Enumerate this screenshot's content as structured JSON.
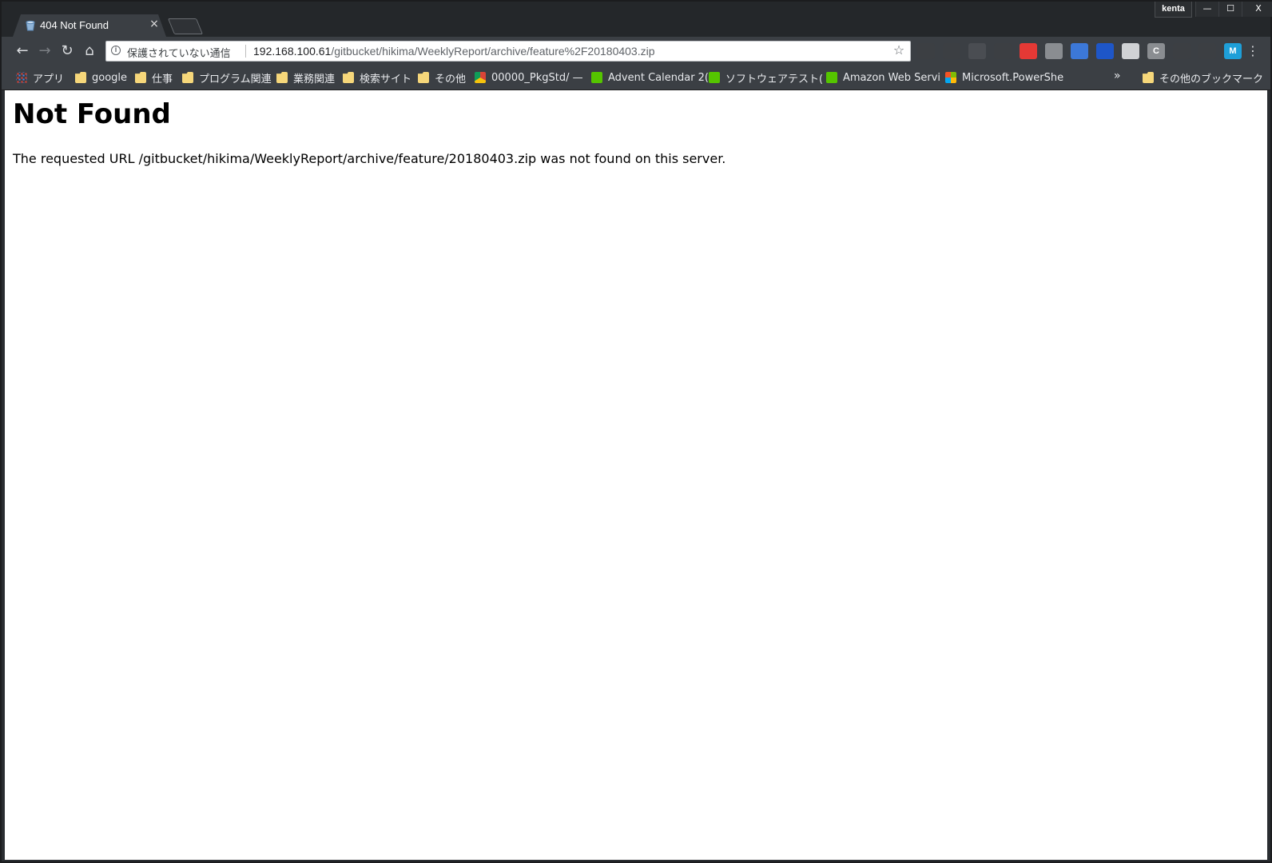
{
  "browser": {
    "tab": {
      "title": "404 Not Found",
      "close": "×",
      "icon": "gitbucket-icon"
    },
    "profile": "kenta",
    "window_controls": {
      "minimize": "—",
      "maximize": "☐",
      "close": "X"
    },
    "nav": {
      "back": "←",
      "forward": "→",
      "reload": "↻",
      "home": "⌂"
    },
    "omnibox": {
      "security_text": "保護されていない通信",
      "url_host": "192.168.100.61",
      "url_path": "/gitbucket/hikima/WeeklyReport/archive/feature%2F20180403.zip",
      "star": "☆"
    },
    "extensions": [
      {
        "name": "ext-1",
        "label": "",
        "color": "#3c3f43"
      },
      {
        "name": "ext-2",
        "label": "",
        "color": "#3c3f43"
      },
      {
        "name": "ext-3",
        "label": "",
        "color": "#4a4d52"
      },
      {
        "name": "ext-4",
        "label": "",
        "color": "#3c3f43"
      },
      {
        "name": "ext-5",
        "label": "",
        "color": "#e53935"
      },
      {
        "name": "ext-6",
        "label": "",
        "color": "#8a8d91"
      },
      {
        "name": "ext-7",
        "label": "",
        "color": "#3c78d8"
      },
      {
        "name": "ext-8",
        "label": "",
        "color": "#1e56c8"
      },
      {
        "name": "ext-9",
        "label": "",
        "color": "#d0d2d5"
      },
      {
        "name": "ext-10",
        "label": "C",
        "color": "#8a8d91"
      },
      {
        "name": "ext-11",
        "label": "",
        "color": "#3c3f43"
      },
      {
        "name": "ext-12",
        "label": "",
        "color": "#3c3f43"
      },
      {
        "name": "ext-13",
        "label": "M",
        "color": "#1e9fd8"
      }
    ],
    "menu": "⋮",
    "bookmarks": [
      {
        "label": "アプリ",
        "icon": "apps"
      },
      {
        "label": "google",
        "icon": "folder"
      },
      {
        "label": "仕事",
        "icon": "folder"
      },
      {
        "label": "プログラム関連",
        "icon": "folder"
      },
      {
        "label": "業務関連",
        "icon": "folder"
      },
      {
        "label": "検索サイト",
        "icon": "folder"
      },
      {
        "label": "その他",
        "icon": "folder"
      },
      {
        "label": "00000_PkgStd/ — ",
        "icon": "chrome"
      },
      {
        "label": "Advent Calendar 2(",
        "icon": "qiita"
      },
      {
        "label": "ソフトウェアテスト(",
        "icon": "qiita"
      },
      {
        "label": "Amazon Web Servi",
        "icon": "qiita"
      },
      {
        "label": "Microsoft.PowerShe",
        "icon": "ms"
      }
    ],
    "bookmarks_overflow": "»",
    "other_bookmarks": "その他のブックマーク"
  },
  "page": {
    "heading": "Not Found",
    "message": "The requested URL /gitbucket/hikima/WeeklyReport/archive/feature/20180403.zip was not found on this server."
  }
}
